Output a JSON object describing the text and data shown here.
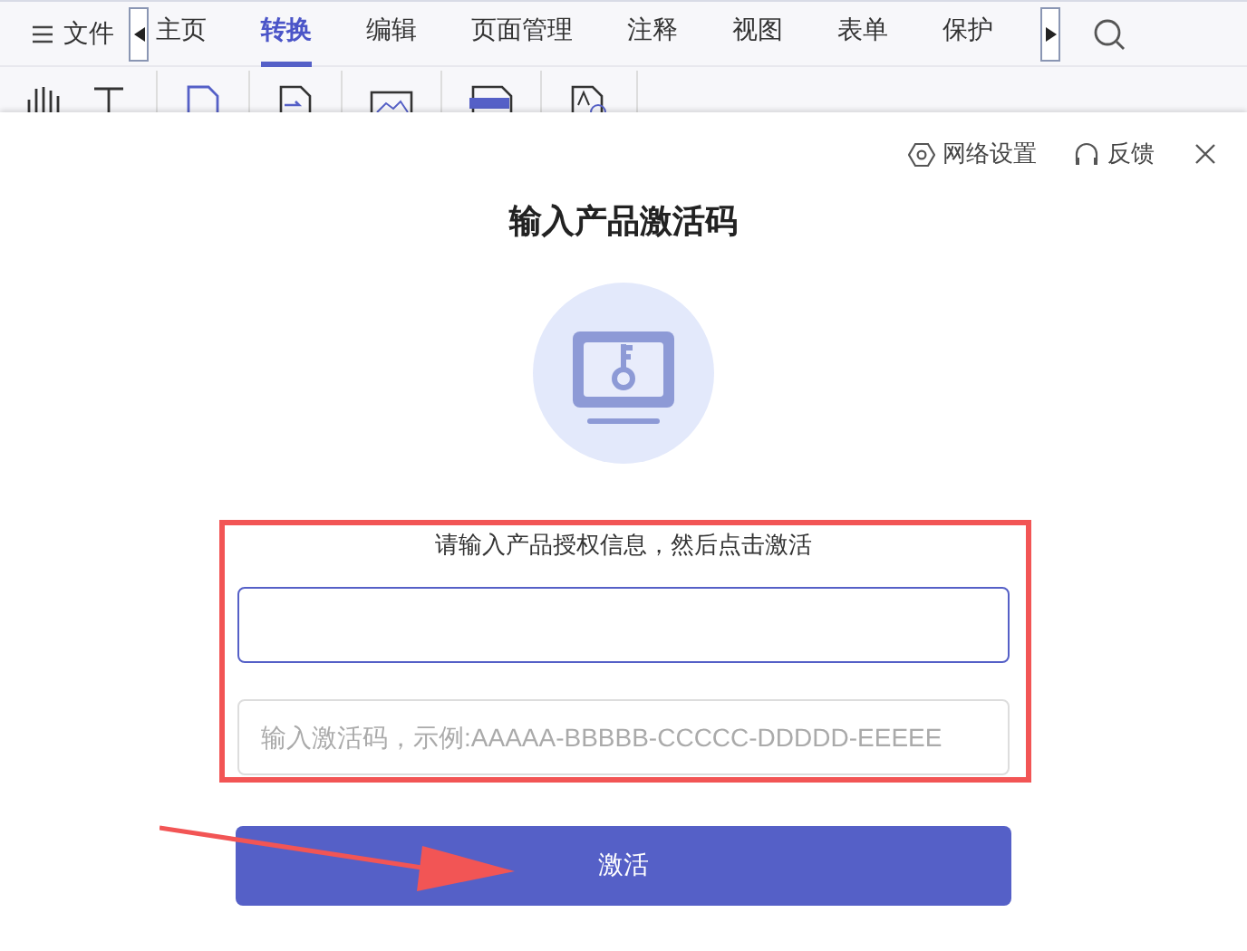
{
  "menu": {
    "file_label": "文件"
  },
  "tabs": [
    {
      "label": "主页",
      "selected": false
    },
    {
      "label": "转换",
      "selected": true
    },
    {
      "label": "编辑",
      "selected": false
    },
    {
      "label": "页面管理",
      "selected": false
    },
    {
      "label": "注释",
      "selected": false
    },
    {
      "label": "视图",
      "selected": false
    },
    {
      "label": "表单",
      "selected": false
    },
    {
      "label": "保护",
      "selected": false
    }
  ],
  "dialog": {
    "links": [
      {
        "kind": "settings",
        "label": "网络设置"
      },
      {
        "kind": "feedback",
        "label": "反馈"
      }
    ],
    "title": "输入产品激活码",
    "instruction": "请输入产品授权信息，然后点击激活",
    "fields": [
      {
        "focused": true
      },
      {
        "placeholder": "输入激活码，示例:AAAAA-BBBBB-CCCCC-DDDDD-EEEEE",
        "focused": false
      }
    ],
    "button": "激活"
  }
}
